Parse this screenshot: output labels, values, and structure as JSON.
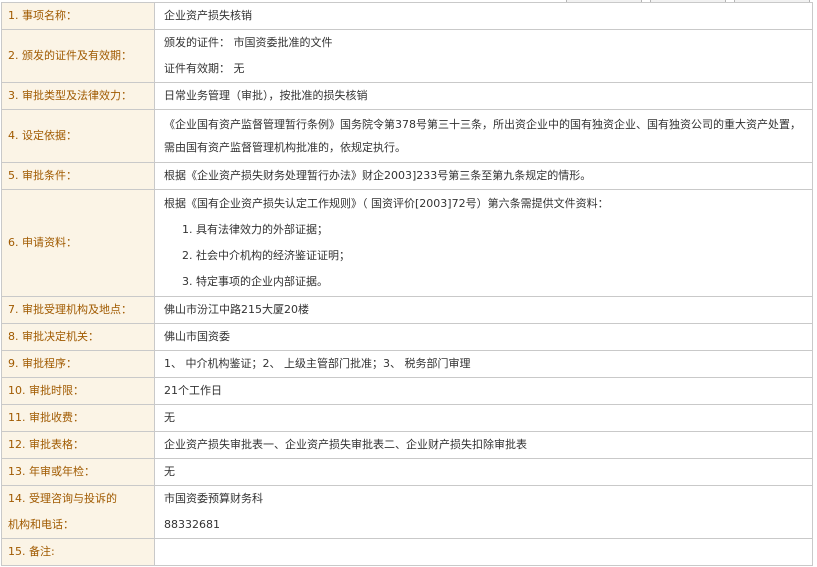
{
  "rows": [
    {
      "label": "1. 事项名称：",
      "lines": [
        "企业资产损失核销"
      ]
    },
    {
      "label": "2. 颁发的证件及有效期：",
      "lines": [
        "颁发的证件： 市国资委批准的文件",
        "证件有效期： 无"
      ]
    },
    {
      "label": "3. 审批类型及法律效力：",
      "lines": [
        "日常业务管理（审批），按批准的损失核销"
      ]
    },
    {
      "label": "4. 设定依据：",
      "text": "《企业国有资产监督管理暂行条例》国务院令第378号第三十三条，所出资企业中的国有独资企业、国有独资公司的重大资产处置，需由国有资产监督管理机构批准的，依规定执行。"
    },
    {
      "label": "5. 审批条件：",
      "lines": [
        "根据《企业资产损失财务处理暂行办法》财企2003]233号第三条至第九条规定的情形。"
      ]
    },
    {
      "label": "6. 申请资料：",
      "intro": "根据《国有企业资产损失认定工作规则》（ 国资评价[2003]72号）第六条需提供文件资料：",
      "items": [
        "1. 具有法律效力的外部证据；",
        "2. 社会中介机构的经济鉴证证明；",
        "3. 特定事项的企业内部证据。"
      ]
    },
    {
      "label": "7. 审批受理机构及地点：",
      "lines": [
        "佛山市汾江中路215大厦20楼"
      ]
    },
    {
      "label": "8. 审批决定机关：",
      "lines": [
        "佛山市国资委"
      ]
    },
    {
      "label": "9. 审批程序：",
      "lines": [
        "1、 中介机构鉴证；2、 上级主管部门批准；3、 税务部门审理"
      ]
    },
    {
      "label": "10. 审批时限：",
      "lines": [
        "21个工作日"
      ]
    },
    {
      "label": "11. 审批收费：",
      "lines": [
        "无"
      ]
    },
    {
      "label": "12. 审批表格：",
      "lines": [
        "企业资产损失审批表一、企业资产损失审批表二、企业财产损失扣除审批表"
      ]
    },
    {
      "label": "13. 年审或年检：",
      "lines": [
        "无"
      ]
    },
    {
      "label_lines": [
        "14. 受理咨询与投诉的",
        "机构和电话："
      ],
      "lines": [
        "市国资委预算财务科",
        "88332681"
      ]
    },
    {
      "label": "15. 备注:",
      "lines": []
    }
  ]
}
